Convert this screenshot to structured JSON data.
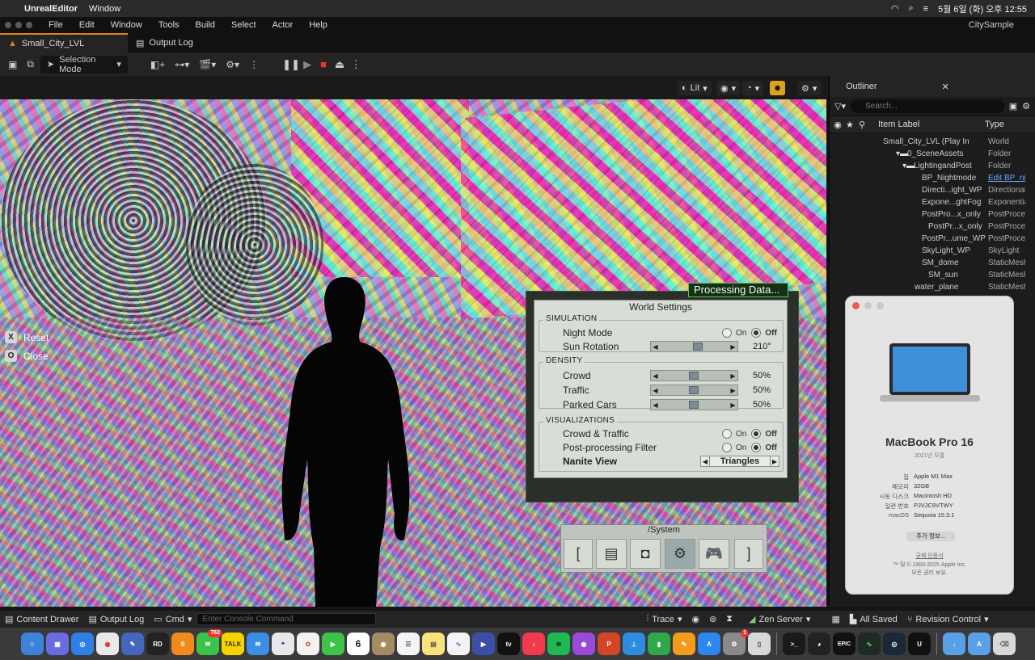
{
  "macmenu": {
    "app": "UnrealEditor",
    "window_menu": "Window",
    "datetime": "5월 6일 (화) 오후 12:55"
  },
  "editor_menu": {
    "items": [
      "File",
      "Edit",
      "Window",
      "Tools",
      "Build",
      "Select",
      "Actor",
      "Help"
    ],
    "project": "CitySample"
  },
  "tabs": {
    "level": "Small_City_LVL",
    "output_log": "Output Log"
  },
  "toolbar": {
    "mode": "Selection Mode"
  },
  "viewport_bar": {
    "lit": "Lit"
  },
  "viewport": {
    "reset_key": "X",
    "reset_label": "Reset",
    "close_key": "O",
    "close_label": "Close"
  },
  "processing": "Processing Data...",
  "world_settings": {
    "title": "World Settings",
    "simulation": {
      "label": "SIMULATION",
      "night_mode": "Night Mode",
      "on": "On",
      "off": "Off",
      "sun_rotation": "Sun Rotation",
      "sun_value": "210°"
    },
    "density": {
      "label": "DENSITY",
      "crowd": "Crowd",
      "crowd_value": "50%",
      "traffic": "Traffic",
      "traffic_value": "50%",
      "parked": "Parked Cars",
      "parked_value": "50%"
    },
    "visualizations": {
      "label": "VISUALIZATIONS",
      "crowd_traffic": "Crowd & Traffic",
      "post_filter": "Post-processing Filter",
      "nanite": "Nanite View",
      "nanite_value": "Triangles"
    }
  },
  "system_panel": {
    "title": "/System"
  },
  "outliner": {
    "title": "Outliner",
    "search_placeholder": "Search...",
    "col_label": "Item Label",
    "col_type": "Type",
    "rows": [
      {
        "label": "Small_City_LVL (Play In",
        "type": "World"
      },
      {
        "label": "0_SceneAssets",
        "type": "Folder"
      },
      {
        "label": "LightingandPost",
        "type": "Folder"
      },
      {
        "label": "BP_Nightmode",
        "type": "Edit BP_nig"
      },
      {
        "label": "Directi...ight_WP",
        "type": "Directional"
      },
      {
        "label": "Expone...ghtFog",
        "type": "Exponentia"
      },
      {
        "label": "PostPro...x_only",
        "type": "PostProces"
      },
      {
        "label": "PostPr...x_only",
        "type": "PostProces"
      },
      {
        "label": "PostPr...ume_WP",
        "type": "PostProces"
      },
      {
        "label": "SkyLight_WP",
        "type": "SkyLight"
      },
      {
        "label": "SM_dome",
        "type": "StaticMesh"
      },
      {
        "label": "SM_sun",
        "type": "StaticMesh"
      },
      {
        "label": "water_plane",
        "type": "StaticMesh"
      }
    ]
  },
  "about_mac": {
    "model": "MacBook Pro 16",
    "year": "2021년 모델",
    "specs": [
      {
        "k": "칩",
        "v": "Apple M1 Max"
      },
      {
        "k": "메모리",
        "v": "32GB"
      },
      {
        "k": "시동 디스크",
        "v": "Macintosh HD"
      },
      {
        "k": "일련 번호",
        "v": "PJVJC9VTWY"
      },
      {
        "k": "macOS",
        "v": "Sequoia 15.3.1"
      }
    ],
    "more_button": "추가 정보...",
    "regulatory": "규제 인증서",
    "copyright": "™ 및 © 1983-2025 Apple Inc.",
    "rights": "모든 권리 보유."
  },
  "statusbar": {
    "content_drawer": "Content Drawer",
    "output_log": "Output Log",
    "cmd": "Cmd",
    "console_placeholder": "Enter Console Command",
    "trace": "Trace",
    "zen": "Zen Server",
    "saved": "All Saved",
    "revision": "Revision Control"
  },
  "dock": {
    "messages_badge": "762",
    "calendar_day": "6",
    "settings_badge": "1"
  },
  "colors": {
    "accent": "#e0821c",
    "processing_green": "#54c354"
  }
}
